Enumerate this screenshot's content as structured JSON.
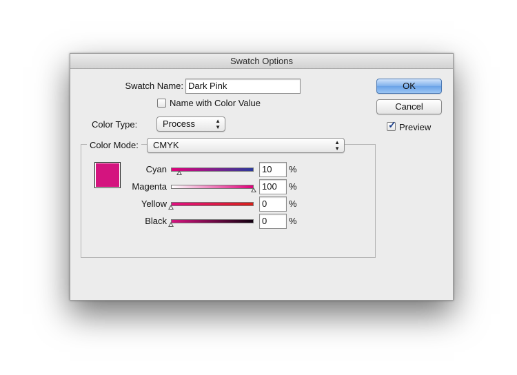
{
  "dialog": {
    "title": "Swatch Options"
  },
  "swatch_name": {
    "label": "Swatch Name:",
    "value": "Dark Pink"
  },
  "name_with_color_value": {
    "label": "Name with Color Value",
    "checked": false
  },
  "color_type": {
    "label": "Color Type:",
    "selected": "Process"
  },
  "color_mode": {
    "label": "Color Mode:",
    "selected": "CMYK"
  },
  "buttons": {
    "ok": "OK",
    "cancel": "Cancel"
  },
  "preview": {
    "label": "Preview",
    "checked": true
  },
  "swatch_color": "#d4147f",
  "sliders": [
    {
      "name": "Cyan",
      "value": "10",
      "unit": "%",
      "fraction": 0.1,
      "gradient": [
        "#e0007a",
        "#2a3a9a"
      ]
    },
    {
      "name": "Magenta",
      "value": "100",
      "unit": "%",
      "fraction": 1.0,
      "gradient": [
        "#ffffff",
        "#e0007a"
      ]
    },
    {
      "name": "Yellow",
      "value": "0",
      "unit": "%",
      "fraction": 0.0,
      "gradient": [
        "#e01080",
        "#d8201a"
      ]
    },
    {
      "name": "Black",
      "value": "0",
      "unit": "%",
      "fraction": 0.0,
      "gradient": [
        "#d4147f",
        "#120010"
      ]
    }
  ]
}
